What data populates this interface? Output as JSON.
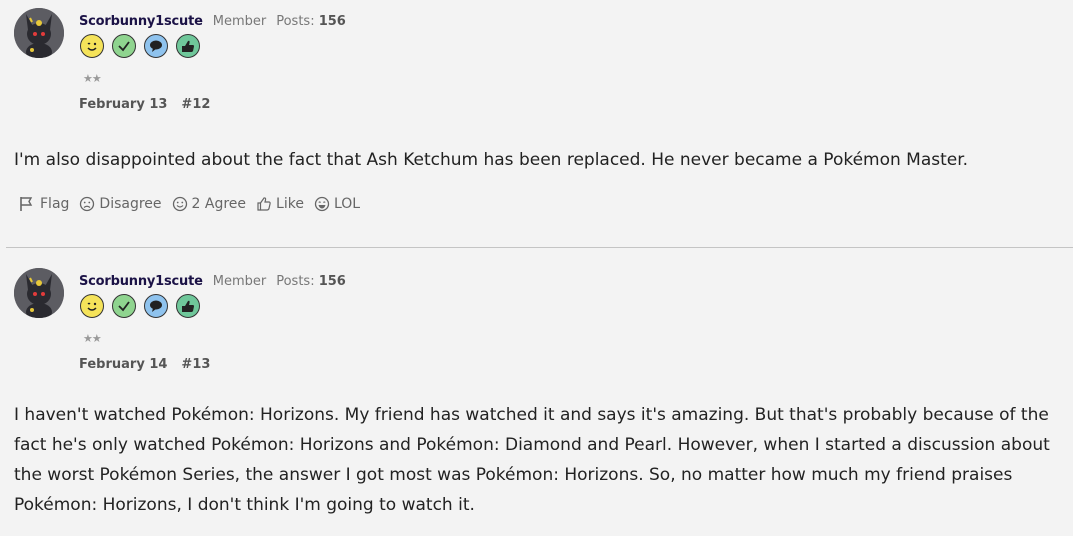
{
  "comments": [
    {
      "username": "Scorbunny1scute",
      "role": "Member",
      "posts_label": "Posts:",
      "posts_count": "156",
      "badges": [
        "wink-face-icon",
        "check-icon",
        "speech-bubble-icon",
        "thumbs-up-icon"
      ],
      "stars": "★★",
      "date": "February 13",
      "permalink": "#12",
      "body": "I'm also disappointed about the fact that Ash Ketchum has been replaced. He never became a Pokémon Master.",
      "reactions": [
        {
          "icon": "flag-icon",
          "label": "Flag"
        },
        {
          "icon": "disagree-face-icon",
          "label": "Disagree"
        },
        {
          "icon": "agree-face-icon",
          "label": "2 Agree"
        },
        {
          "icon": "like-thumb-icon",
          "label": "Like"
        },
        {
          "icon": "lol-face-icon",
          "label": "LOL"
        }
      ]
    },
    {
      "username": "Scorbunny1scute",
      "role": "Member",
      "posts_label": "Posts:",
      "posts_count": "156",
      "badges": [
        "wink-face-icon",
        "check-icon",
        "speech-bubble-icon",
        "thumbs-up-icon"
      ],
      "stars": "★★",
      "date": "February 14",
      "permalink": "#13",
      "body": "I haven't watched Pokémon: Horizons. My friend has watched it and says it's amazing. But that's probably because of the fact he's only watched Pokémon: Horizons and Pokémon: Diamond and Pearl. However, when I started a discussion about the worst Pokémon Series, the answer I got most was Pokémon: Horizons. So, no matter how much my friend praises Pokémon: Horizons, I don't think I'm going to watch it."
    }
  ],
  "colors": {
    "background": "#f3f3f3",
    "username": "#1b1246",
    "badge_yellow": "#f5e35a",
    "badge_green": "#8fd48f",
    "badge_blue": "#8fc3ee",
    "badge_teal": "#6fc79a"
  }
}
